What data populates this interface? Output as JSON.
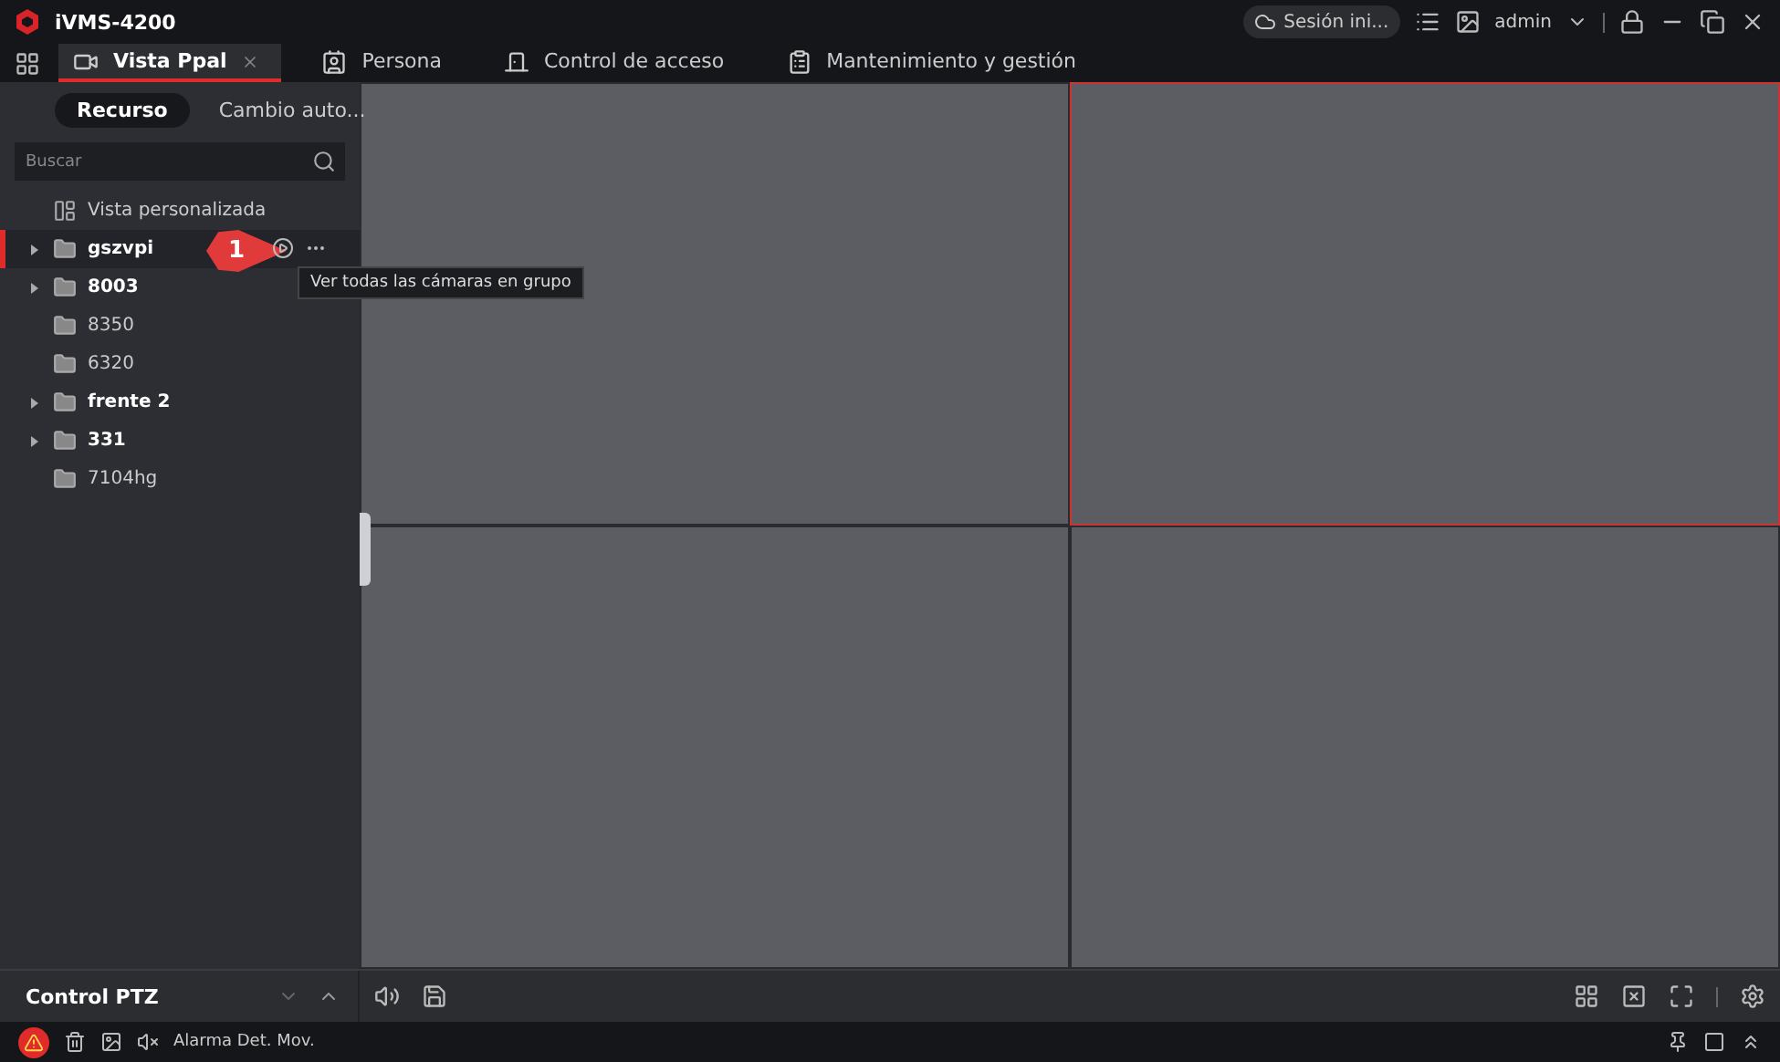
{
  "window": {
    "title": "iVMS-4200",
    "cloud_status": "Sesión ini...",
    "user": "admin"
  },
  "tabs": [
    {
      "label": "Vista Ppal",
      "selected": true,
      "closable": true
    },
    {
      "label": "Persona",
      "selected": false,
      "closable": false
    },
    {
      "label": "Control de acceso",
      "selected": false,
      "closable": false
    },
    {
      "label": "Mantenimiento y gestión",
      "selected": false,
      "closable": false
    }
  ],
  "sidebar": {
    "modes": [
      {
        "label": "Recurso",
        "selected": true
      },
      {
        "label": "Cambio auto...",
        "selected": false
      }
    ],
    "search": {
      "placeholder": "Buscar"
    },
    "items": [
      {
        "label": "Vista personalizada",
        "kind": "view",
        "expandable": false,
        "selected": false
      },
      {
        "label": "gszvpi",
        "kind": "group",
        "expandable": true,
        "selected": true
      },
      {
        "label": "8003",
        "kind": "group",
        "expandable": true,
        "selected": false
      },
      {
        "label": "8350",
        "kind": "group",
        "expandable": false,
        "selected": false
      },
      {
        "label": "6320",
        "kind": "group",
        "expandable": false,
        "selected": false
      },
      {
        "label": "frente 2",
        "kind": "group",
        "expandable": true,
        "selected": false
      },
      {
        "label": "331",
        "kind": "group",
        "expandable": true,
        "selected": false
      },
      {
        "label": "7104hg",
        "kind": "group",
        "expandable": false,
        "selected": false
      }
    ],
    "callout": "1",
    "tooltip": "Ver todas las cámaras en grupo",
    "ptz": "Control PTZ"
  },
  "video_cells": [
    {
      "selected": false
    },
    {
      "selected": true
    },
    {
      "selected": false
    },
    {
      "selected": false
    }
  ],
  "status_bar": {
    "alarm": "Alarma Det. Mov."
  }
}
